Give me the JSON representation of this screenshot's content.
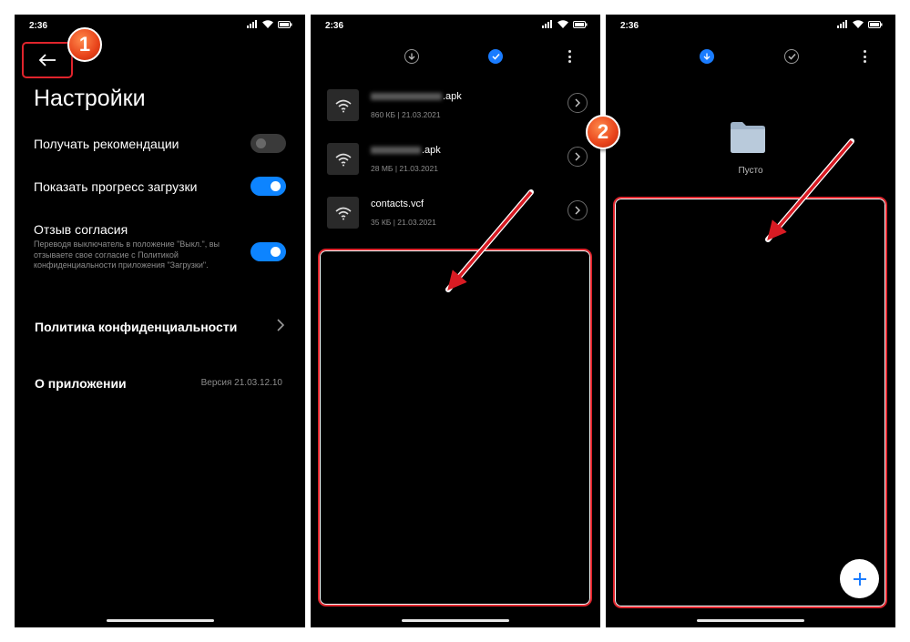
{
  "screens": [
    {
      "status": {
        "time": "2:36"
      },
      "settings": {
        "title": "Настройки",
        "items": [
          {
            "label": "Получать рекомендации",
            "toggle": "off"
          },
          {
            "label": "Показать прогресс загрузки",
            "toggle": "on"
          },
          {
            "label": "Отзыв согласия",
            "toggle": "on",
            "description": "Переводя выключатель в положение \"Выкл.\", вы отзываете свое согласие с Политикой конфиденциальности приложения \"Загрузки\"."
          }
        ],
        "policy": "Политика конфиденциальности",
        "about": "О приложении",
        "version": "Версия 21.03.12.10"
      }
    },
    {
      "status": {
        "time": "2:36"
      },
      "files": [
        {
          "name": ".apk",
          "meta": "860 КБ | 21.03.2021"
        },
        {
          "name": ".apk",
          "meta": "28 МБ | 21.03.2021"
        },
        {
          "name": "contacts.vcf",
          "meta": "35 КБ | 21.03.2021"
        }
      ]
    },
    {
      "status": {
        "time": "2:36"
      },
      "empty_label": "Пусто"
    }
  ],
  "annotations": {
    "step1": "1",
    "step2": "2"
  },
  "colors": {
    "accent": "#0d84ff",
    "highlight": "#e0242c",
    "badge": "#e8431a"
  }
}
